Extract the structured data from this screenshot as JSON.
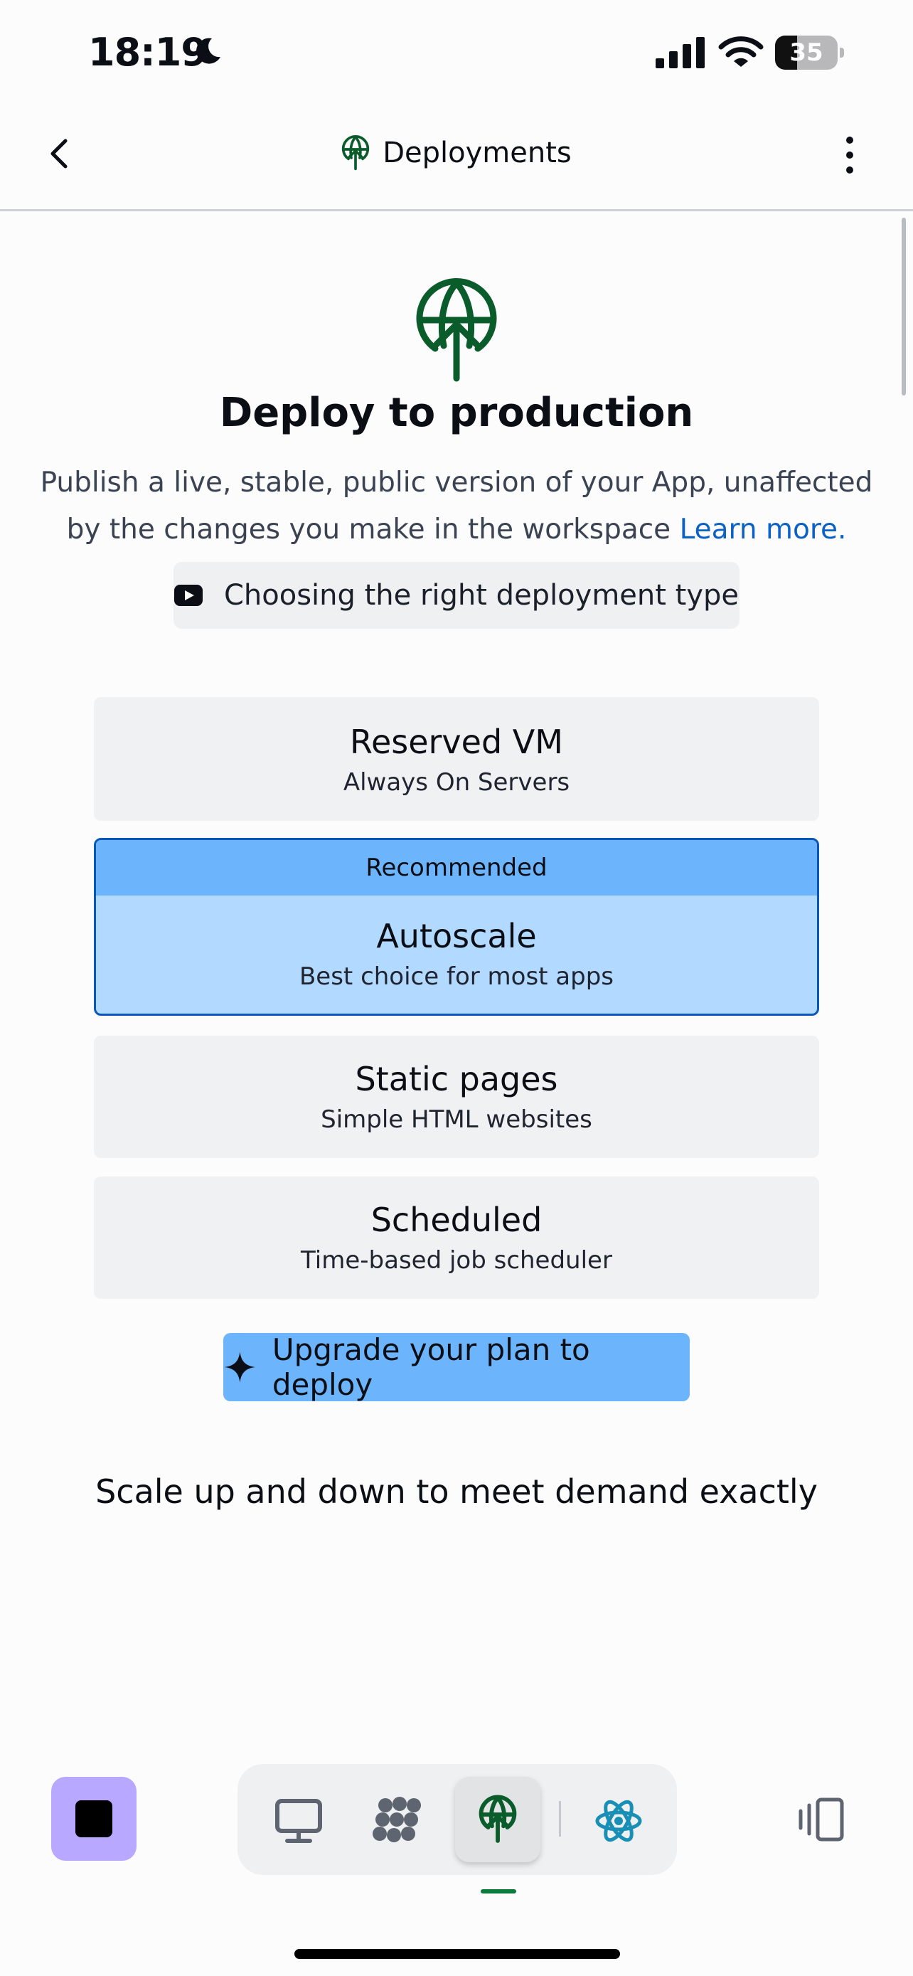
{
  "status_bar": {
    "time": "18:19",
    "battery_level": "35",
    "icons": [
      "moon-icon",
      "cellular-signal-icon",
      "wifi-icon",
      "battery-icon"
    ]
  },
  "header": {
    "title": "Deployments",
    "icons": [
      "back-chevron-icon",
      "deploy-globe-icon",
      "more-vertical-icon"
    ]
  },
  "hero": {
    "title": "Deploy to production",
    "description": "Publish a live, stable, public version of your App, unaffected by the changes you make in the workspace",
    "learn_more": "Learn more.",
    "video_link": "Choosing the right deployment type"
  },
  "deployment_types": [
    {
      "title": "Reserved VM",
      "subtitle": "Always On Servers"
    },
    {
      "badge": "Recommended",
      "title": "Autoscale",
      "subtitle": "Best choice for most apps",
      "selected": true
    },
    {
      "title": "Static pages",
      "subtitle": "Simple HTML websites"
    },
    {
      "title": "Scheduled",
      "subtitle": "Time-based job scheduler"
    }
  ],
  "upgrade_button": "Upgrade your plan to deploy",
  "tagline": "Scale up and down to meet demand exactly",
  "bottom_bar": {
    "items": [
      "stop-button",
      "webview-icon",
      "workspace-grid-icon",
      "deploy-globe-icon",
      "react-icon",
      "panels-icon"
    ],
    "active": "deploy-globe-icon"
  },
  "colors": {
    "accent_green": "#0a5c2a",
    "link_blue": "#0b62c4",
    "selected_bg": "#b2d9ff",
    "selected_header": "#6cb4fb",
    "selected_border": "#0a57b8",
    "stop_button": "#b8a8ff"
  }
}
